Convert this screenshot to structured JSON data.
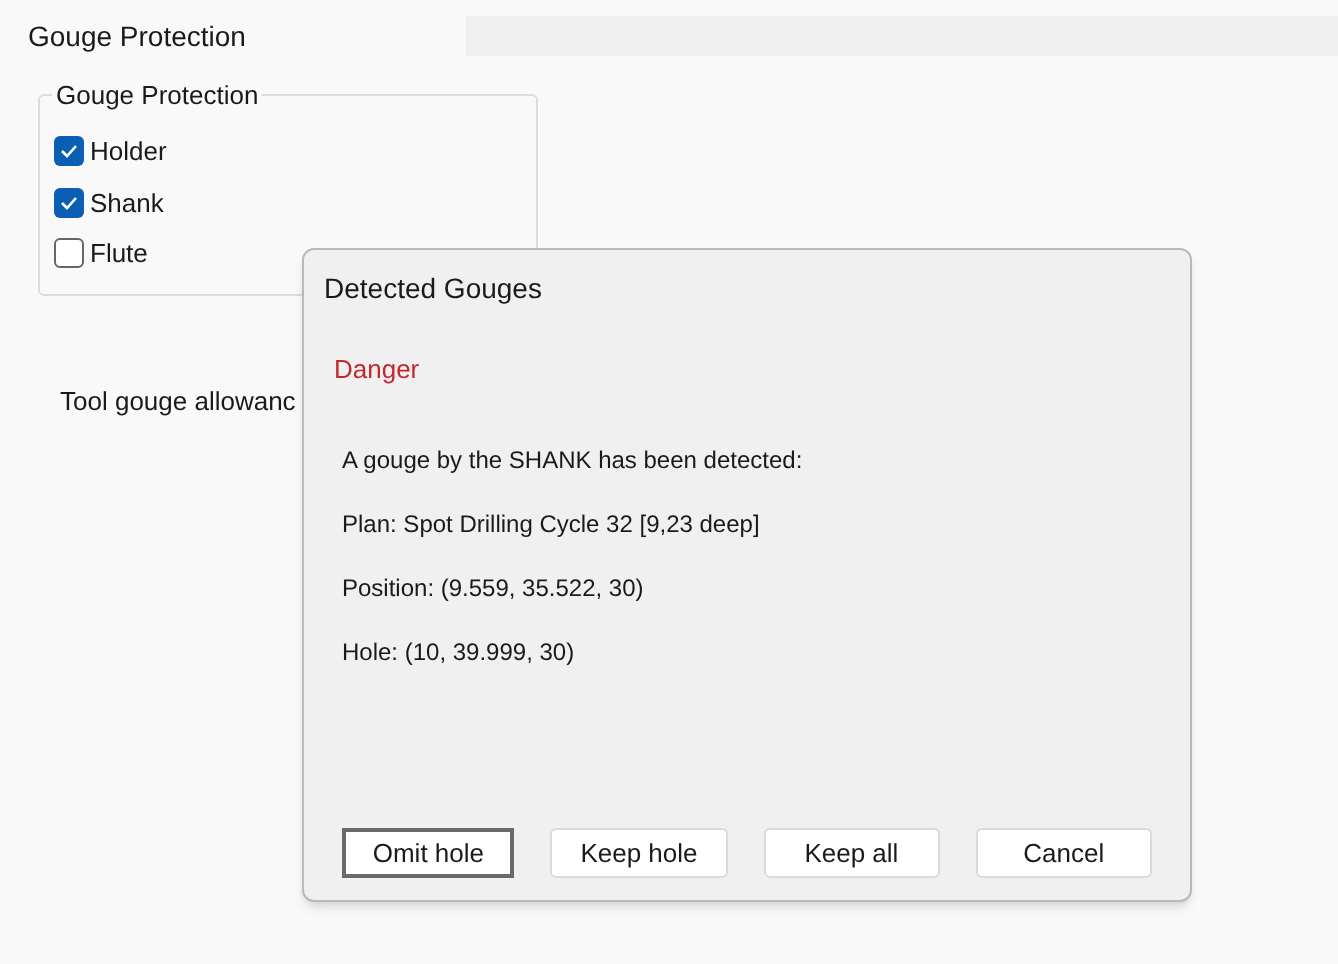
{
  "page": {
    "title": "Gouge Protection"
  },
  "group": {
    "title": "Gouge Protection",
    "options": [
      {
        "label": "Holder",
        "checked": true
      },
      {
        "label": "Shank",
        "checked": true
      },
      {
        "label": "Flute",
        "checked": false
      }
    ]
  },
  "allowance": {
    "label": "Tool gouge allowanc"
  },
  "dialog": {
    "title": "Detected Gouges",
    "severity": "Danger",
    "lines": [
      "A gouge by the SHANK has been detected:",
      "Plan: Spot Drilling Cycle 32 [9,23 deep]",
      "Position: (9.559, 35.522, 30)",
      "Hole: (10, 39.999, 30)"
    ],
    "buttons": [
      {
        "label": "Omit hole",
        "default": true
      },
      {
        "label": "Keep hole",
        "default": false
      },
      {
        "label": "Keep all",
        "default": false
      },
      {
        "label": "Cancel",
        "default": false
      }
    ]
  }
}
